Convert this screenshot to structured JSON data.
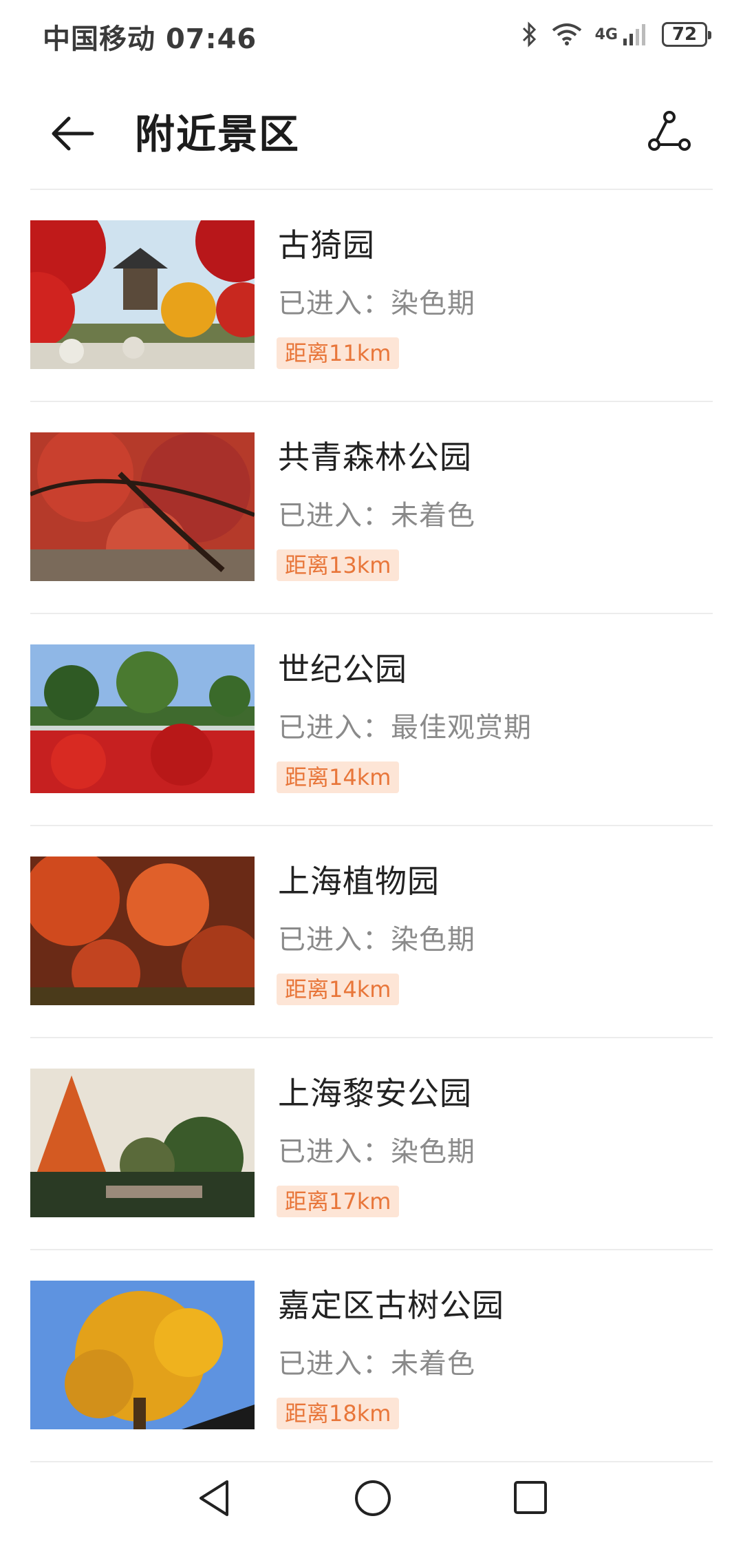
{
  "status": {
    "carrier": "中国移动",
    "time": "07:46",
    "battery": "72",
    "network": "4G"
  },
  "header": {
    "title": "附近景区"
  },
  "stage_prefix": "已进入：",
  "items": [
    {
      "name": "古猗园",
      "stage": "染色期",
      "distance": "距离11km"
    },
    {
      "name": "共青森林公园",
      "stage": "未着色",
      "distance": "距离13km"
    },
    {
      "name": "世纪公园",
      "stage": "最佳观赏期",
      "distance": "距离14km"
    },
    {
      "name": "上海植物园",
      "stage": "染色期",
      "distance": "距离14km"
    },
    {
      "name": "上海黎安公园",
      "stage": "染色期",
      "distance": "距离17km"
    },
    {
      "name": "嘉定区古树公园",
      "stage": "未着色",
      "distance": "距离18km"
    }
  ],
  "colors": {
    "accent": "#e8763a",
    "badge_bg": "#fde5d6",
    "text_secondary": "#8a8a8a"
  },
  "icons": [
    "bluetooth-icon",
    "wifi-icon",
    "signal-icon",
    "battery-icon",
    "back-arrow-icon",
    "route-icon",
    "nav-back-icon",
    "nav-home-icon",
    "nav-recent-icon"
  ]
}
